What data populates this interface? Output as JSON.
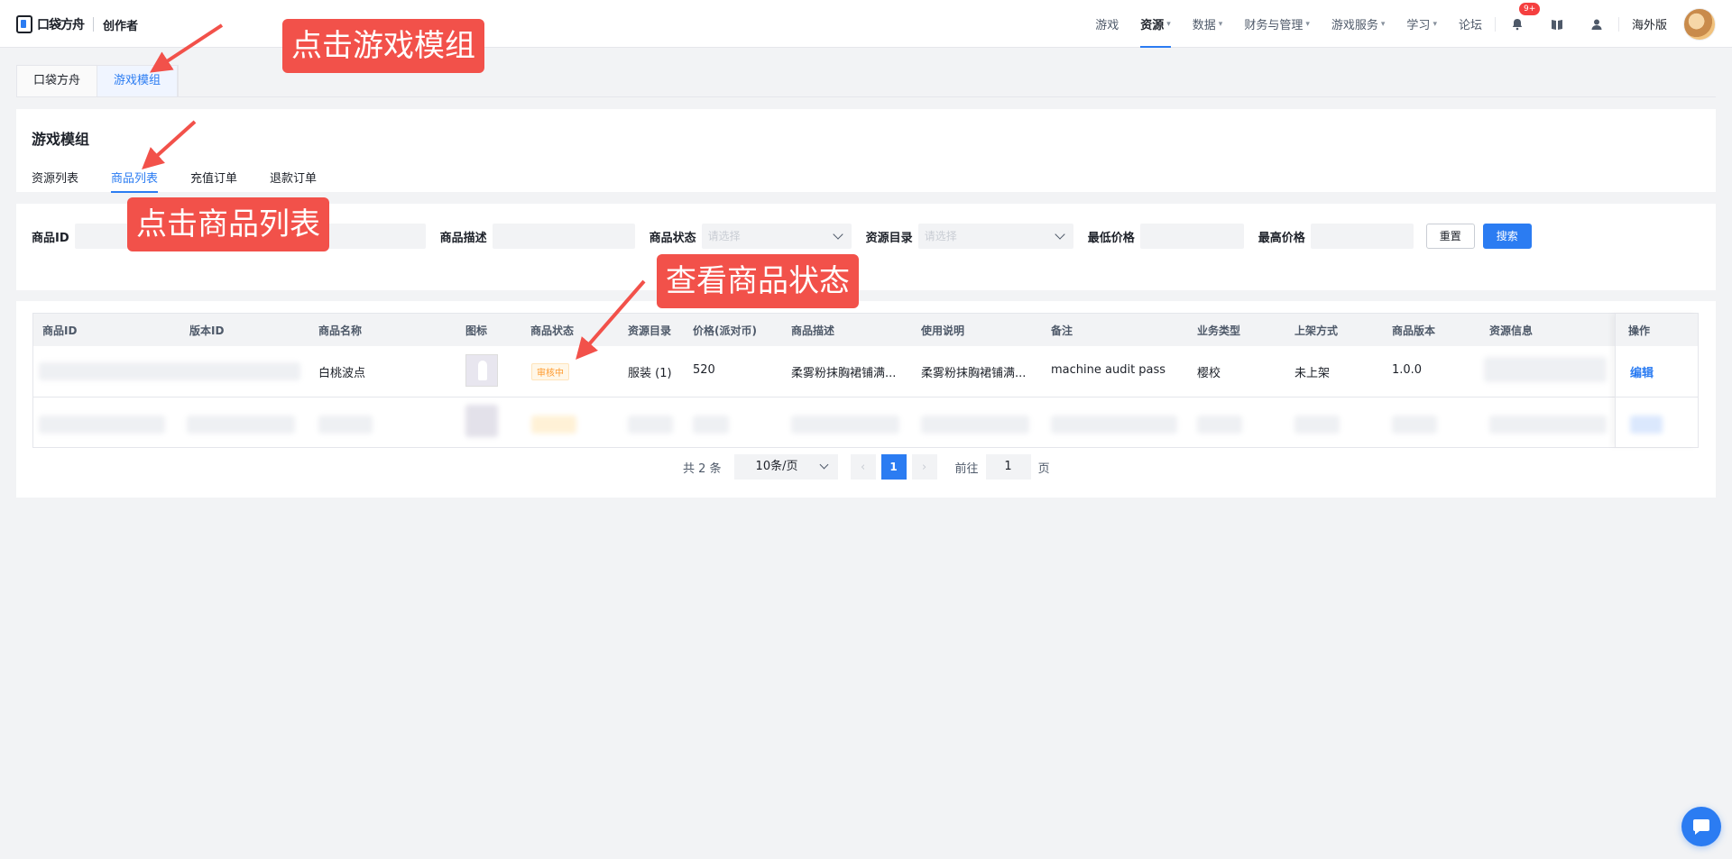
{
  "brand": {
    "name": "口袋方舟",
    "sub": "创作者"
  },
  "nav": {
    "items": [
      {
        "label": "游戏",
        "chevron": false,
        "active": false
      },
      {
        "label": "资源",
        "chevron": true,
        "active": true
      },
      {
        "label": "数据",
        "chevron": true,
        "active": false
      },
      {
        "label": "财务与管理",
        "chevron": true,
        "active": false
      },
      {
        "label": "游戏服务",
        "chevron": true,
        "active": false
      },
      {
        "label": "学习",
        "chevron": true,
        "active": false
      },
      {
        "label": "论坛",
        "chevron": false,
        "active": false
      }
    ],
    "notification_badge": "9+",
    "overseas": "海外版"
  },
  "app_tabs": [
    "口袋方舟",
    "游戏模组"
  ],
  "section": {
    "title": "游戏模组",
    "tabs": [
      "资源列表",
      "商品列表",
      "充值订单",
      "退款订单"
    ]
  },
  "filters": {
    "product_id_label": "商品ID",
    "product_desc_label": "商品描述",
    "product_status_label": "商品状态",
    "product_status_placeholder": "请选择",
    "resource_dir_label": "资源目录",
    "resource_dir_placeholder": "请选择",
    "min_price_label": "最低价格",
    "max_price_label": "最高价格",
    "reset_label": "重置",
    "search_label": "搜索"
  },
  "table": {
    "headers": [
      "商品ID",
      "版本ID",
      "商品名称",
      "图标",
      "商品状态",
      "资源目录",
      "价格(派对币)",
      "商品描述",
      "使用说明",
      "备注",
      "业务类型",
      "上架方式",
      "商品版本",
      "资源信息",
      "操作"
    ],
    "row1": {
      "name": "白桃波点",
      "status": "审核中",
      "dir": "服装 (1)",
      "price": "520",
      "desc": "柔雾粉抹胸裙铺满...",
      "usage": "柔雾粉抹胸裙铺满...",
      "note": "machine audit pass",
      "biz": "樱校",
      "listing": "未上架",
      "version": "1.0.0",
      "action": "编辑"
    }
  },
  "pagination": {
    "total": "共 2 条",
    "page_size": "10条/页",
    "current": "1",
    "goto_label": "前往",
    "goto_value": "1",
    "page_suffix": "页"
  },
  "annotations": {
    "click_mod": "点击游戏模组",
    "click_list": "点击商品列表",
    "view_status": "查看商品状态"
  },
  "colors": {
    "accent": "#2b7cf2",
    "callout": "#f2514a",
    "badge": "#f53f3f",
    "pending": "#ff9a2e"
  }
}
